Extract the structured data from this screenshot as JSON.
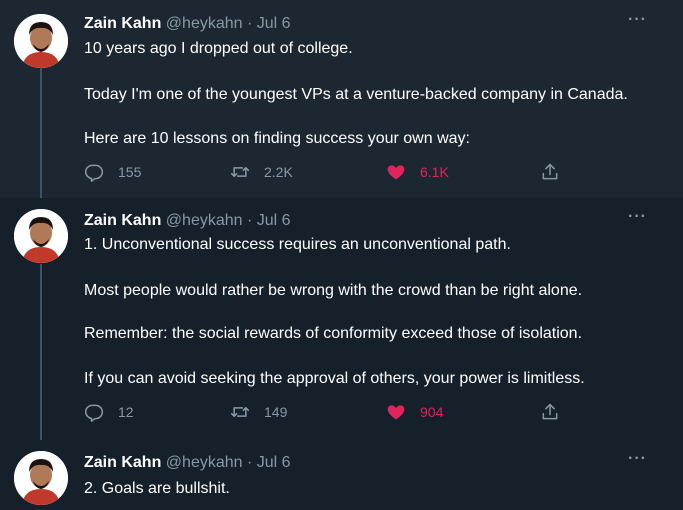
{
  "tweets": [
    {
      "author": "Zain Kahn",
      "meta": "@heykahn · Jul 6",
      "more": "···",
      "paragraphs": [
        "10 years ago I dropped out of college.",
        "Today I'm one of the youngest VPs at a venture-backed company in Canada.",
        "Here are 10 lessons on finding success your own way:"
      ],
      "replies": "155",
      "retweets": "2.2K",
      "likes": "6.1K",
      "liked": true
    },
    {
      "author": "Zain Kahn",
      "meta": "@heykahn · Jul 6",
      "more": "···",
      "paragraphs": [
        "1. Unconventional success requires an unconventional path.",
        "Most people would rather be wrong with the crowd than be right alone.",
        "Remember: the social rewards of conformity exceed those of isolation.",
        "If you can avoid seeking the approval of others, your power is limitless."
      ],
      "replies": "12",
      "retweets": "149",
      "likes": "904",
      "liked": true
    },
    {
      "author": "Zain Kahn",
      "meta": "@heykahn · Jul 6",
      "more": "···",
      "paragraphs": [
        "2.  Goals are bullshit."
      ]
    }
  ],
  "colors": {
    "background": "#15202b",
    "highlight": "#1c2732",
    "muted": "#8899a6",
    "like": "#e0245e",
    "thread_line": "#3d5466"
  },
  "icons": [
    "more-icon",
    "reply-icon",
    "retweet-icon",
    "like-icon",
    "share-icon"
  ]
}
